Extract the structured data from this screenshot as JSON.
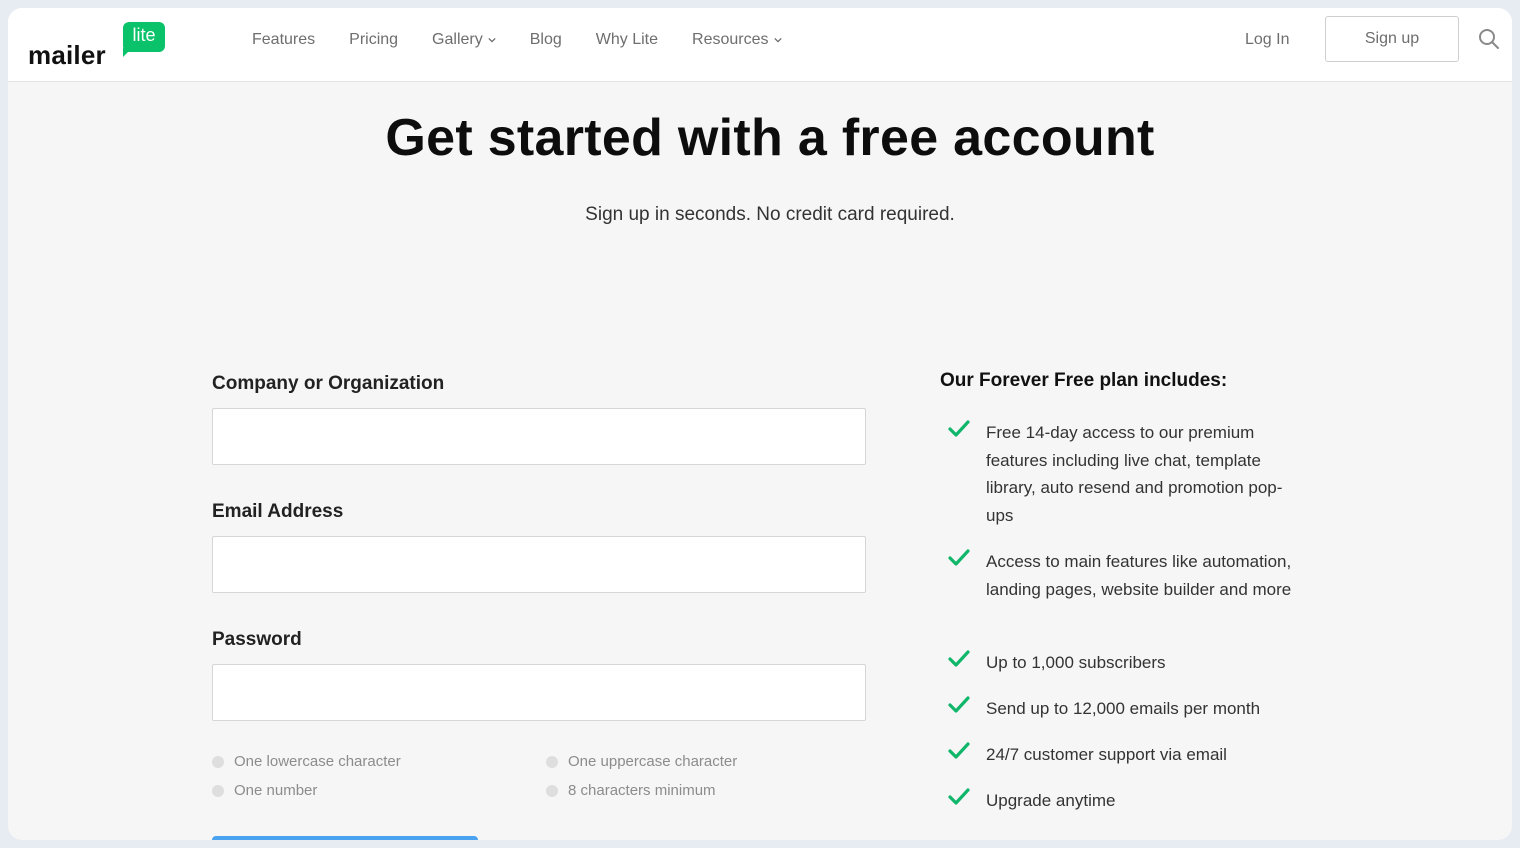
{
  "header": {
    "logo_word": "mailer",
    "logo_badge": "lite",
    "nav": [
      {
        "label": "Features",
        "has_dropdown": false
      },
      {
        "label": "Pricing",
        "has_dropdown": false
      },
      {
        "label": "Gallery",
        "has_dropdown": true
      },
      {
        "label": "Blog",
        "has_dropdown": false
      },
      {
        "label": "Why Lite",
        "has_dropdown": false
      },
      {
        "label": "Resources",
        "has_dropdown": true
      }
    ],
    "login_label": "Log In",
    "signup_label": "Sign up",
    "search_icon": "search-icon"
  },
  "hero": {
    "title": "Get started with a free account",
    "subtitle": "Sign up in seconds. No credit card required."
  },
  "form": {
    "company": {
      "label": "Company or Organization",
      "value": ""
    },
    "email": {
      "label": "Email Address",
      "value": ""
    },
    "password": {
      "label": "Password",
      "value": ""
    },
    "requirements": [
      "One lowercase character",
      "One uppercase character",
      "One number",
      "8 characters minimum"
    ]
  },
  "plan": {
    "title": "Our Forever Free plan includes:",
    "items": [
      "Free 14-day access to our premium features including live chat, template library, auto resend and promotion pop-ups",
      "Access to main features like automation, landing pages, website builder and more",
      "Up to 1,000 subscribers",
      "Send up to 12,000 emails per month",
      "24/7 customer support via email",
      "Upgrade anytime"
    ]
  },
  "colors": {
    "brand_green": "#09c269",
    "check_green": "#10b66a",
    "page_bg": "#f6f6f6",
    "frame_bg": "#e6ecf2"
  }
}
